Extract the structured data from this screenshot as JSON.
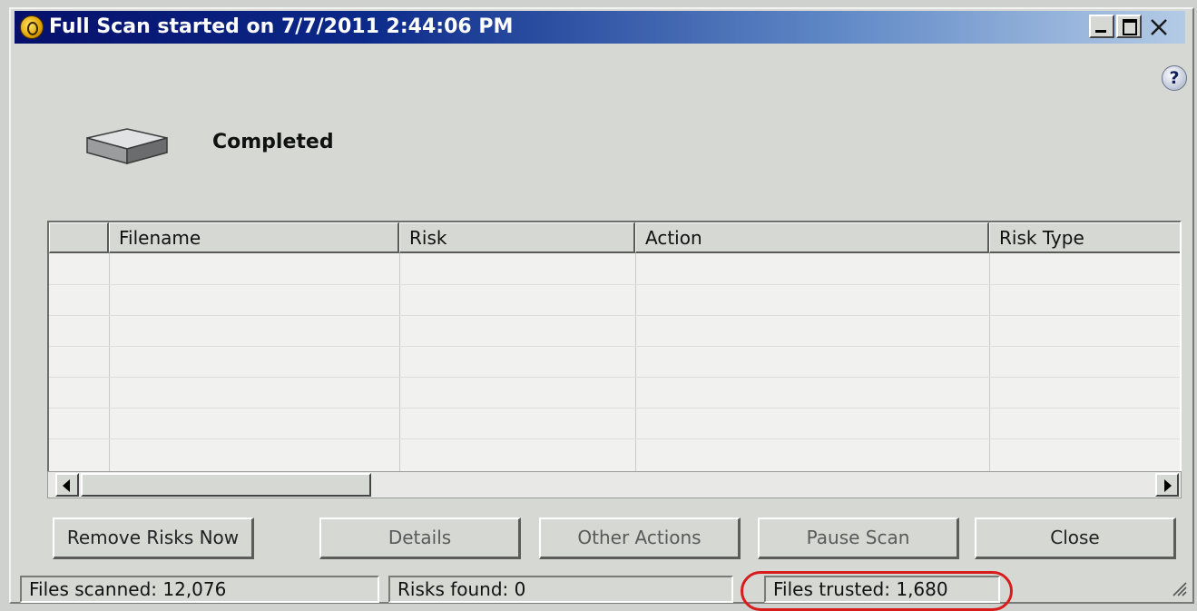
{
  "window": {
    "title": "Full Scan started on 7/7/2011 2:44:06 PM",
    "help_icon": "help-icon",
    "app_icon": "app-logo-icon"
  },
  "status": {
    "label": "Completed",
    "icon": "hard-drive-icon"
  },
  "grid": {
    "columns": [
      "",
      "Filename",
      "Risk",
      "Action",
      "Risk Type"
    ],
    "rows": []
  },
  "buttons": {
    "remove_risks": "Remove Risks Now",
    "details": "Details",
    "other_actions": "Other Actions",
    "pause_scan": "Pause Scan",
    "close": "Close"
  },
  "statusbar": {
    "files_scanned": "Files scanned: 12,076",
    "risks_found": "Risks found: 0",
    "files_trusted": "Files trusted: 1,680"
  },
  "colors": {
    "title_gradient_start": "#06106a",
    "title_gradient_end": "#b4cbe6",
    "highlight_ring": "#d81c1c",
    "face": "#d6d8d4"
  }
}
